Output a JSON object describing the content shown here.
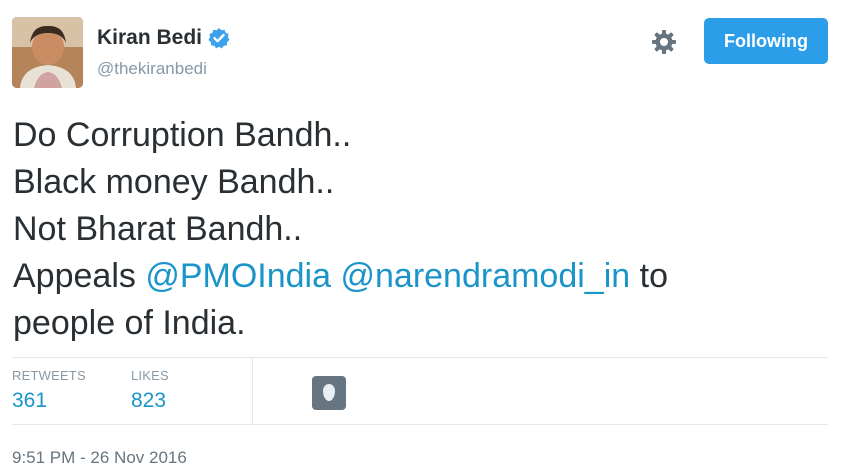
{
  "author": {
    "display_name": "Kiran Bedi",
    "handle": "@thekiranbedi",
    "verified": true
  },
  "actions": {
    "follow_label": "Following",
    "settings_icon": "gear-icon"
  },
  "tweet": {
    "line1": "Do Corruption Bandh..",
    "line2": "Black money Bandh..",
    "line3": "Not Bharat Bandh..",
    "line4_prefix": "Appeals ",
    "mention1": "@PMOIndia",
    "mention2": "@narendramodi_in",
    "line4_suffix": " to",
    "line5": "people of India."
  },
  "stats": {
    "retweets_label": "RETWEETS",
    "retweets_value": "361",
    "likes_label": "LIKES",
    "likes_value": "823"
  },
  "timestamp": "9:51 PM - 26 Nov 2016",
  "colors": {
    "accent": "#1b95c9",
    "follow_button": "#2b9de9",
    "muted": "#8899a6"
  }
}
